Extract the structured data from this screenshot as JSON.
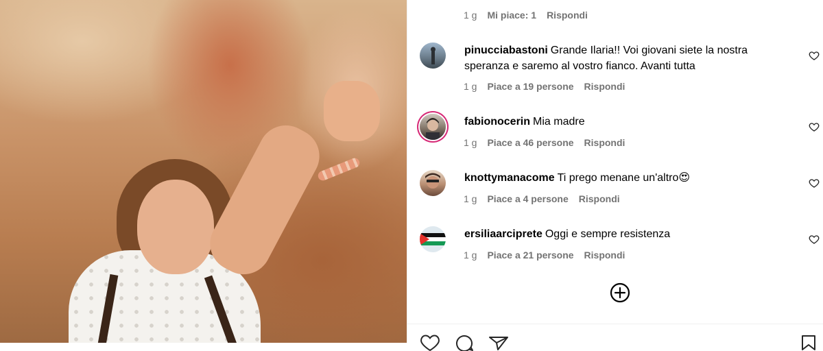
{
  "post": {
    "image_alt": "Woman with pigtails raising a clenched fist in front of a painted mural"
  },
  "comments": [
    {
      "username": "",
      "text": "",
      "age": "1 g",
      "likes": "Mi piace: 1",
      "reply": "Rispondi"
    },
    {
      "username": "pinucciabastoni",
      "text": "Grande Ilaria!! Voi giovani siete la nostra speranza e saremo al vostro fianco. Avanti tutta",
      "age": "1 g",
      "likes": "Piace a 19 persone",
      "reply": "Rispondi"
    },
    {
      "username": "fabionocerin",
      "text": "Mia madre",
      "age": "1 g",
      "likes": "Piace a 46 persone",
      "reply": "Rispondi"
    },
    {
      "username": "knottymanacome",
      "text": "Ti prego menane un'altro😍",
      "age": "1 g",
      "likes": "Piace a 4 persone",
      "reply": "Rispondi"
    },
    {
      "username": "ersiliaarciprete",
      "text": "Oggi e sempre resistenza",
      "age": "1 g",
      "likes": "Piace a 21 persone",
      "reply": "Rispondi"
    }
  ],
  "icons": {
    "like_comment": "heart-outline-icon",
    "load_more": "plus-circle-icon",
    "like_post": "heart-icon",
    "comment_post": "comment-icon",
    "share_post": "send-icon",
    "save_post": "bookmark-icon"
  },
  "colors": {
    "meta_text": "#737373",
    "story_ring": "#d62976",
    "divider": "#efefef"
  }
}
